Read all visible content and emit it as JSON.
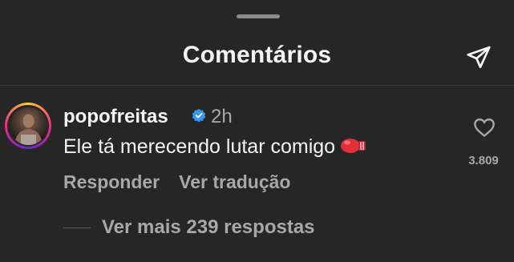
{
  "header": {
    "title": "Comentários"
  },
  "comment": {
    "username": "popofreitas",
    "time": "2h",
    "text": "Ele tá merecendo lutar comigo",
    "emoji_icon": "boxing-glove",
    "actions": {
      "reply": "Responder",
      "translate": "Ver tradução"
    },
    "likes": "3.809",
    "view_replies": "Ver mais 239 respostas"
  },
  "colors": {
    "background": "#262626",
    "primary_text": "#f5f5f5",
    "secondary_text": "#a8a8a8",
    "verified": "#3897f0"
  }
}
